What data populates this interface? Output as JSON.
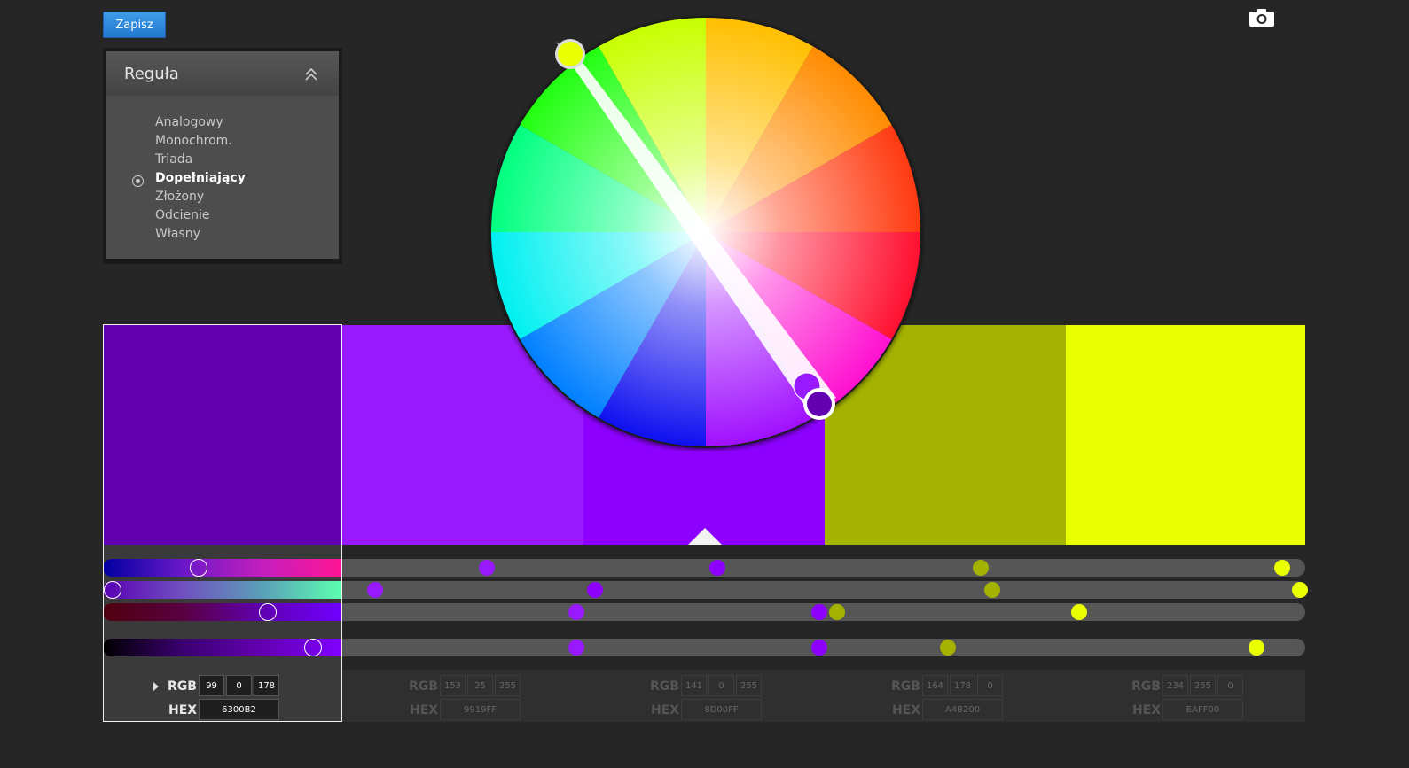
{
  "toolbar": {
    "save_label": "Zapisz"
  },
  "rule_panel": {
    "title": "Reguła",
    "items": [
      "Analogowy",
      "Monochrom.",
      "Triada",
      "Dopełniający",
      "Złożony",
      "Odcienie",
      "Własny"
    ],
    "selected": "Dopełniający"
  },
  "swatches": [
    {
      "color": "#6300B2",
      "r": "99",
      "g": "0",
      "b": "178",
      "hex": "6300B2"
    },
    {
      "color": "#9919FF",
      "r": "153",
      "g": "25",
      "b": "255",
      "hex": "9919FF"
    },
    {
      "color": "#8D00FF",
      "r": "141",
      "g": "0",
      "b": "255",
      "hex": "8D00FF"
    },
    {
      "color": "#A4B200",
      "r": "164",
      "g": "178",
      "b": "0",
      "hex": "A4B200"
    },
    {
      "color": "#EAFF00",
      "r": "234",
      "g": "255",
      "b": "0",
      "hex": "EAFF00"
    }
  ],
  "labels": {
    "rgb": "RGB",
    "hex": "HEX"
  }
}
